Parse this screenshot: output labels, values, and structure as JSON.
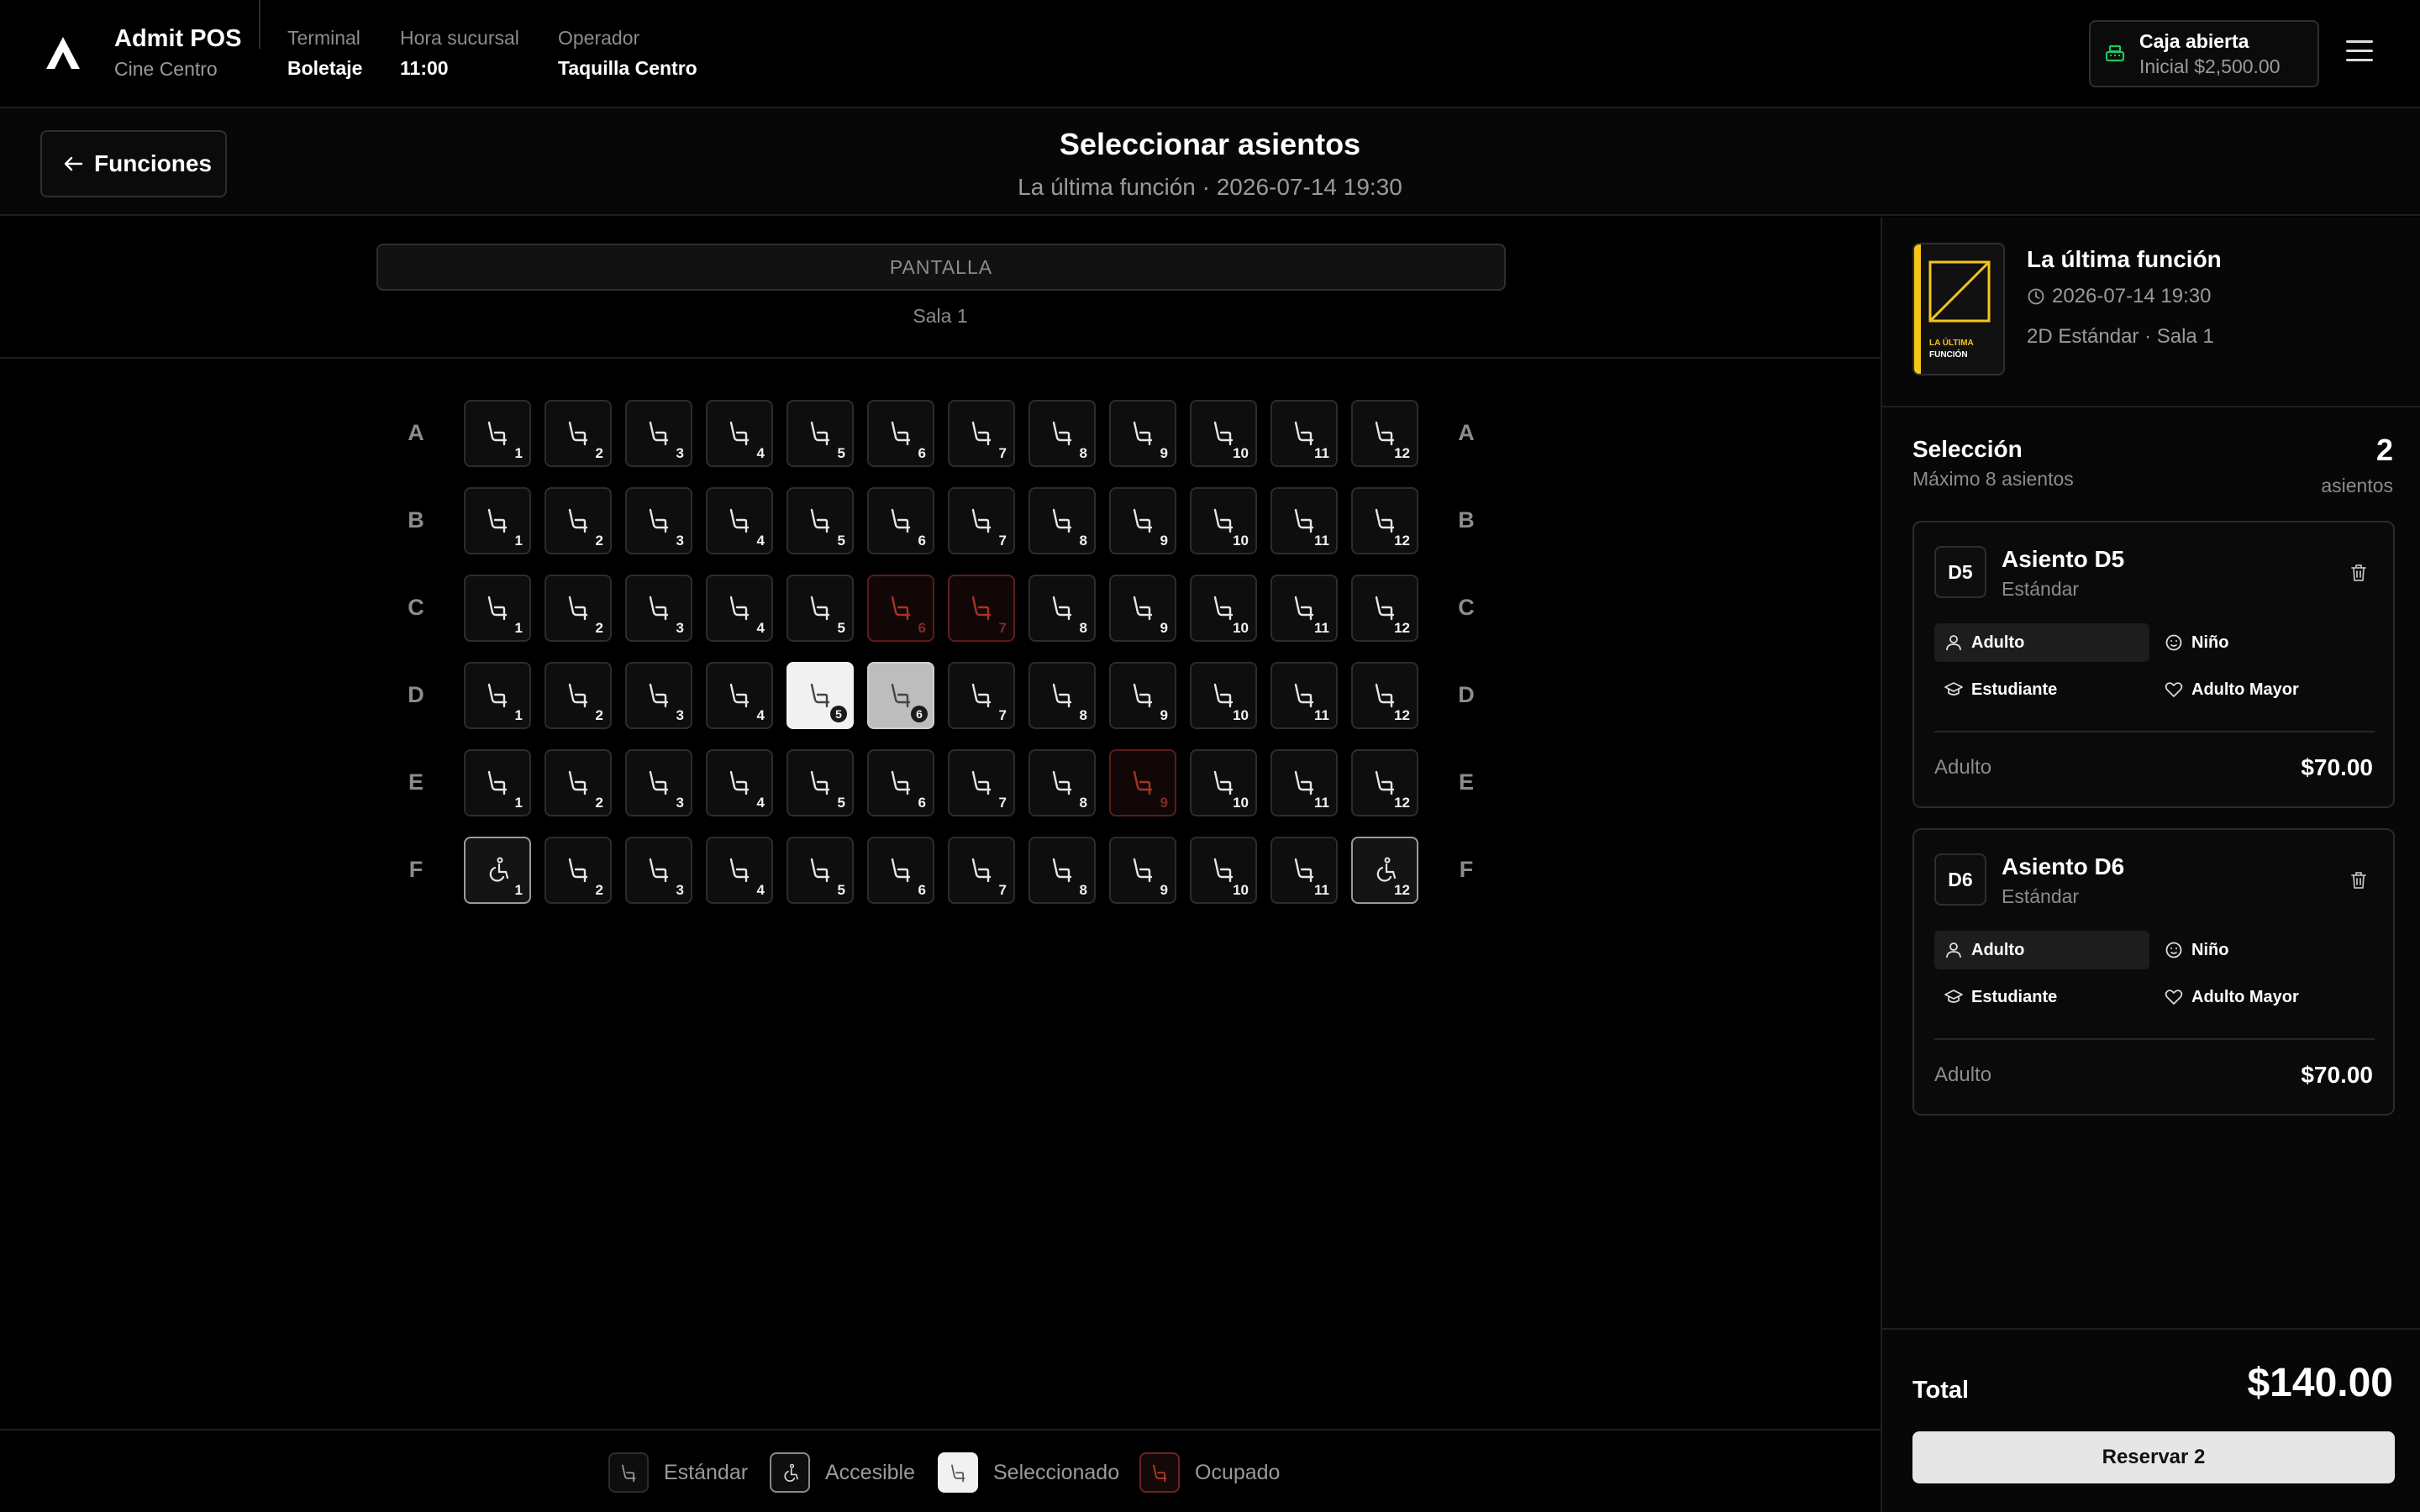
{
  "app": {
    "name": "Admit POS",
    "location": "Cine Centro"
  },
  "header": {
    "terminal_label": "Terminal",
    "terminal_value": "Boletaje",
    "hora_label": "Hora sucursal",
    "hora_value": "11:00",
    "operador_label": "Operador",
    "operador_value": "Taquilla Centro",
    "caja_title": "Caja abierta",
    "caja_sub": "Inicial $2,500.00"
  },
  "subheader": {
    "back_label": "Funciones",
    "title": "Seleccionar asientos",
    "subtitle": "La última función · 2026-07-14 19:30"
  },
  "seatmap": {
    "screen_label": "PANTALLA",
    "room_label": "Sala 1",
    "rows": [
      {
        "label": "A",
        "seats": [
          "standard",
          "standard",
          "standard",
          "standard",
          "standard",
          "standard",
          "standard",
          "standard",
          "standard",
          "standard",
          "standard",
          "standard"
        ]
      },
      {
        "label": "B",
        "seats": [
          "standard",
          "standard",
          "standard",
          "standard",
          "standard",
          "standard",
          "standard",
          "standard",
          "standard",
          "standard",
          "standard",
          "standard"
        ]
      },
      {
        "label": "C",
        "seats": [
          "standard",
          "standard",
          "standard",
          "standard",
          "standard",
          "occupied",
          "occupied",
          "standard",
          "standard",
          "standard",
          "standard",
          "standard"
        ]
      },
      {
        "label": "D",
        "seats": [
          "standard",
          "standard",
          "standard",
          "standard",
          "selected1",
          "selected2",
          "standard",
          "standard",
          "standard",
          "standard",
          "standard",
          "standard"
        ]
      },
      {
        "label": "E",
        "seats": [
          "standard",
          "standard",
          "standard",
          "standard",
          "standard",
          "standard",
          "standard",
          "standard",
          "occupied",
          "standard",
          "standard",
          "standard"
        ]
      },
      {
        "label": "F",
        "seats": [
          "accessible",
          "standard",
          "standard",
          "standard",
          "standard",
          "standard",
          "standard",
          "standard",
          "standard",
          "standard",
          "standard",
          "accessible"
        ]
      }
    ],
    "seat_numbers": [
      "1",
      "2",
      "3",
      "4",
      "5",
      "6",
      "7",
      "8",
      "9",
      "10",
      "11",
      "12"
    ]
  },
  "legend": {
    "standard": "Estándar",
    "accessible": "Accesible",
    "selected": "Seleccionado",
    "occupied": "Ocupado"
  },
  "colors": {
    "accent": "#f5c518",
    "occupied": "#c0392b",
    "caja_icon": "#22c55e"
  },
  "panel": {
    "poster_line1": "LA ÚLTIMA",
    "poster_line2": "FUNCIÓN",
    "movie_title": "La última función",
    "movie_date": "2026-07-14 19:30",
    "movie_format": "2D Estándar · Sala 1",
    "selection_title": "Selección",
    "selection_sub": "Máximo 8 asientos",
    "selection_count": "2",
    "selection_unit": "asientos",
    "tickets": [
      {
        "code": "D5",
        "title": "Asiento D5",
        "type": "Estándar",
        "opt_adult": "Adulto",
        "opt_child": "Niño",
        "opt_student": "Estudiante",
        "opt_senior": "Adulto Mayor",
        "fare": "Adulto",
        "price": "$70.00"
      },
      {
        "code": "D6",
        "title": "Asiento D6",
        "type": "Estándar",
        "opt_adult": "Adulto",
        "opt_child": "Niño",
        "opt_student": "Estudiante",
        "opt_senior": "Adulto Mayor",
        "fare": "Adulto",
        "price": "$70.00"
      }
    ],
    "total_label": "Total",
    "total_value": "$140.00",
    "reserve_label": "Reservar 2"
  }
}
